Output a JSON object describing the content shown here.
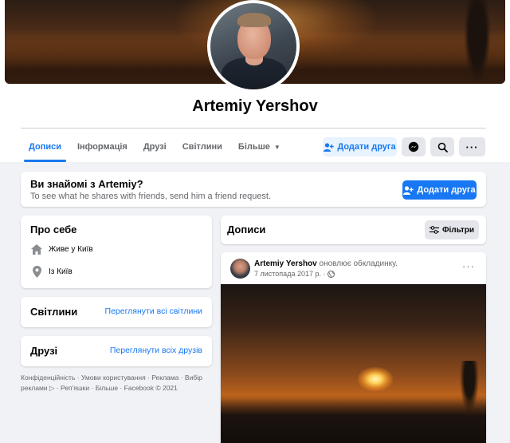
{
  "profile": {
    "name": "Artemiy Yershov"
  },
  "tabs": [
    {
      "label": "Дописи"
    },
    {
      "label": "Інформація"
    },
    {
      "label": "Друзі"
    },
    {
      "label": "Світлини"
    },
    {
      "label": "Більше"
    }
  ],
  "actions": {
    "add_friend": "Додати друга",
    "more": "···"
  },
  "know_card": {
    "title": "Ви знайомі з Artemiy?",
    "subtitle": "To see what he shares with friends, send him a friend request.",
    "button": "Додати друга"
  },
  "about": {
    "title": "Про себе",
    "lives": "Живе у Київ",
    "from": "Із Київ"
  },
  "photos": {
    "title": "Світлини",
    "link": "Переглянути всі світлини"
  },
  "friends": {
    "title": "Друзі",
    "link": "Переглянути всіх друзів"
  },
  "footer": {
    "text": "Конфіденційність · Умови користування · Реклама · Вибір реклами ▷ · Реп'яшки · Більше · Facebook © 2021"
  },
  "posts": {
    "title": "Дописи",
    "filter": "Фільтри",
    "items": [
      {
        "author": "Artemiy Yershov",
        "action": "оновлює обкладинку.",
        "date": "7 листопада 2017 р. ·",
        "menu": "···"
      }
    ]
  },
  "colors": {
    "accent": "#1877f2",
    "accent_light": "#e7f3ff",
    "background": "#f0f2f5",
    "secondary_text": "#65676b"
  }
}
